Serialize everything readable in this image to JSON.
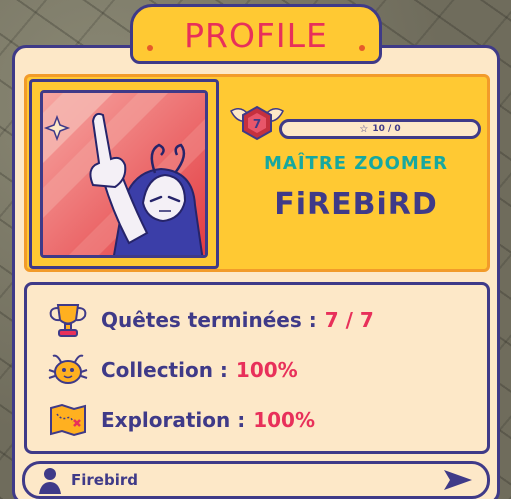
{
  "profile": {
    "title": "PROFILE",
    "level": "7",
    "xp_text": "10 / 0",
    "rank": "MAÎTRE ZOOMER",
    "player_name": "FiREBiRD"
  },
  "stats": [
    {
      "icon": "trophy-icon",
      "label": "Quêtes terminées :",
      "value": "7 / 7"
    },
    {
      "icon": "creature-icon",
      "label": "Collection :",
      "value": "100%"
    },
    {
      "icon": "treasure-map-icon",
      "label": "Exploration :",
      "value": "100%"
    }
  ],
  "name_input": {
    "value": "Firebird"
  },
  "colors": {
    "accent_pink": "#e8305a",
    "teal": "#16a8a0",
    "navy": "#3f3a88",
    "gold": "#ffc933",
    "cream": "#fde8c8"
  }
}
